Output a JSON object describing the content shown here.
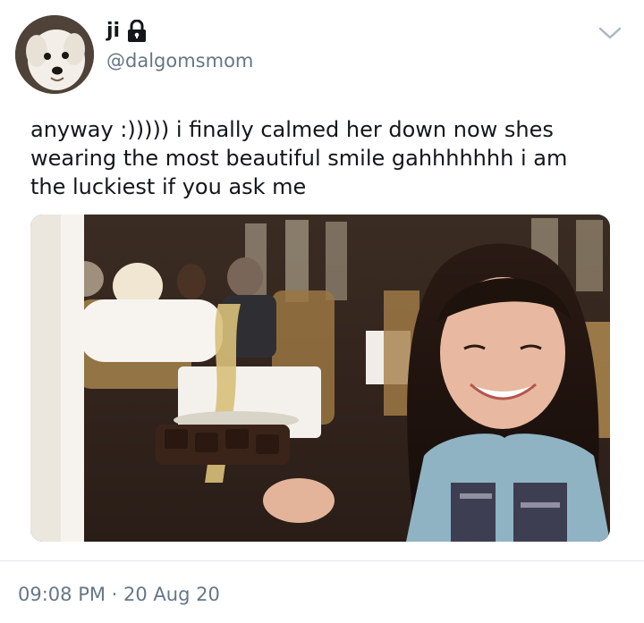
{
  "tweet": {
    "author": {
      "display_name": "ji",
      "handle": "@dalgomsmom",
      "protected_icon": "lock-icon",
      "avatar_icon": "dog-avatar"
    },
    "menu_icon": "chevron-down-icon",
    "text": "anyway :))))) i finally calmed her down now shes\nwearing the most beautiful smile gahhhhhhh i am\nthe luckiest if you ask me",
    "media_description_icon": "photo",
    "timestamp": "09:08 PM · 20 Aug 20"
  },
  "colors": {
    "text_primary": "#14171a",
    "text_secondary": "#657786",
    "divider": "#e1e8ed",
    "chevron": "#aab8c2"
  }
}
